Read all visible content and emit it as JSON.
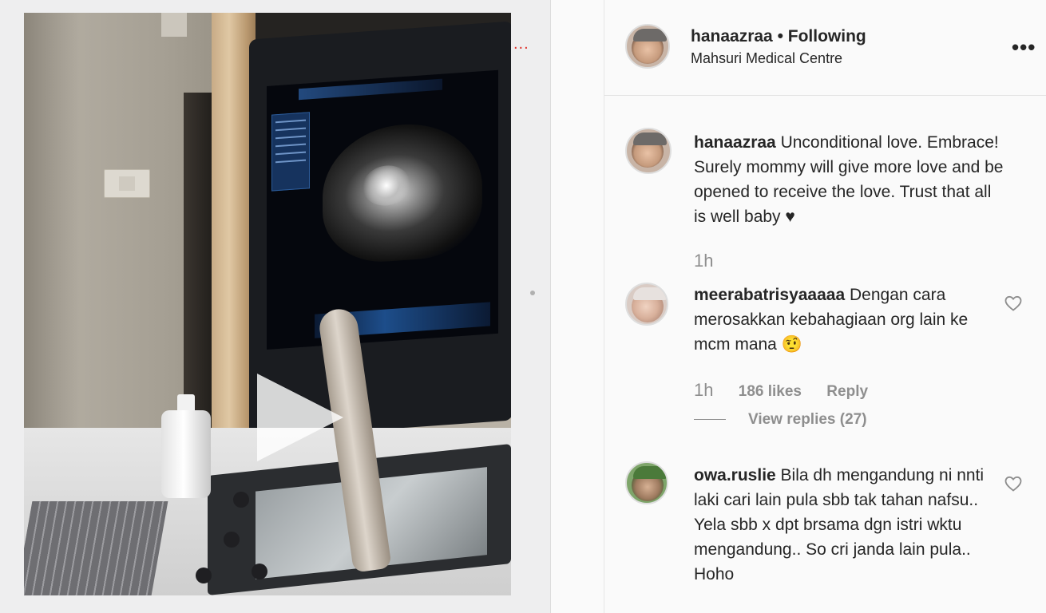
{
  "post": {
    "author": "hanaazraa",
    "separator": "•",
    "follow_status": "Following",
    "location": "Mahsuri Medical Centre",
    "more_icon": "more-horizontal-icon"
  },
  "caption": {
    "username": "hanaazraa",
    "text": "Unconditional love. Embrace! Surely mommy will give more love and be opened to receive the love. Trust that all is well baby ♥",
    "time": "1h"
  },
  "comments": [
    {
      "username": "meerabatrisyaaaaa",
      "text": "Dengan cara merosakkan kebahagiaan org lain ke mcm mana 🤨",
      "time": "1h",
      "likes": "186 likes",
      "reply_label": "Reply",
      "view_replies": "View replies (27)"
    },
    {
      "username": "owa.ruslie",
      "text": "Bila dh mengandung ni nnti laki cari lain pula sbb tak tahan nafsu.. Yela sbb x dpt brsama dgn istri wktu mengandung.. So cri janda lain pula.. Hoho"
    }
  ],
  "media": {
    "type": "video",
    "dots": "..."
  },
  "colors": {
    "text": "#262626",
    "muted": "#8e8e8e",
    "border": "#e2e2e2"
  }
}
